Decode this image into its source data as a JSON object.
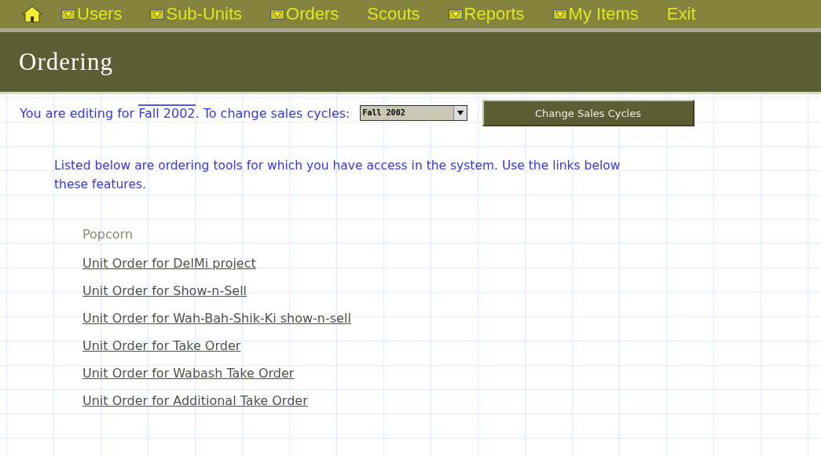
{
  "nav": {
    "items": [
      {
        "label": "Users",
        "has_menu": true
      },
      {
        "label": "Sub-Units",
        "has_menu": true
      },
      {
        "label": "Orders",
        "has_menu": true
      },
      {
        "label": "Scouts",
        "has_menu": false
      },
      {
        "label": "Reports",
        "has_menu": true
      },
      {
        "label": "My Items",
        "has_menu": true
      },
      {
        "label": "Exit",
        "has_menu": false
      }
    ]
  },
  "page_title": "Ordering",
  "cycle_bar": {
    "prefix": "You are editing for",
    "current_cycle": "Fall 2002",
    "suffix": ". To change sales cycles:",
    "select_value": "Fall 2002",
    "button": "Change Sales Cycles"
  },
  "intro_lines": [
    "Listed below are ordering tools for which you have access in the system. Use the links below",
    "these features."
  ],
  "section": {
    "heading": "Popcorn",
    "links": [
      "Unit Order for DelMi project",
      "Unit Order for Show-n-Sell",
      "Unit Order for Wah-Bah-Shik-Ki show-n-sell",
      "Unit Order for Take Order",
      "Unit Order for Wabash Take Order",
      "Unit Order for Additional Take Order"
    ]
  }
}
